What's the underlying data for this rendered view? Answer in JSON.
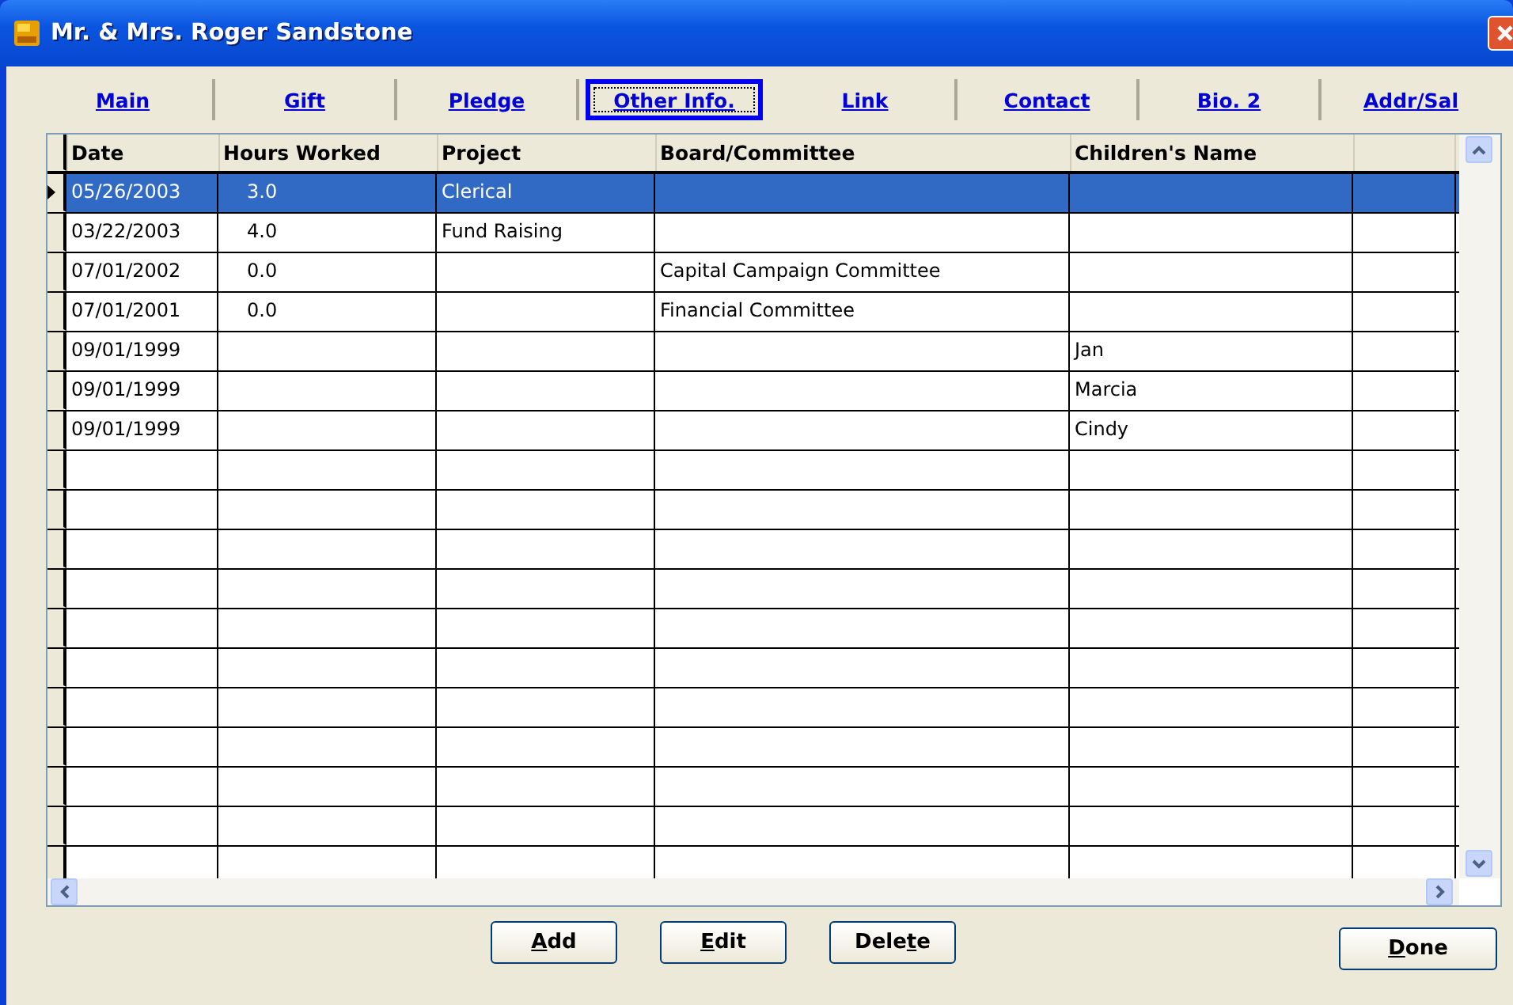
{
  "window": {
    "title": "Mr. & Mrs. Roger Sandstone"
  },
  "tabs": [
    {
      "label": "Main",
      "selected": false
    },
    {
      "label": "Gift",
      "selected": false
    },
    {
      "label": "Pledge",
      "selected": false
    },
    {
      "label": "Other Info.",
      "selected": true
    },
    {
      "label": "Link",
      "selected": false
    },
    {
      "label": "Contact",
      "selected": false
    },
    {
      "label": "Bio. 2",
      "selected": false
    },
    {
      "label": "Addr/Sal",
      "selected": false
    }
  ],
  "table": {
    "columns": [
      "Date",
      "Hours Worked",
      "Project",
      "Board/Committee",
      "Children's Name"
    ],
    "rows": [
      {
        "selected": true,
        "cells": [
          "05/26/2003",
          "3.0",
          "Clerical",
          "",
          ""
        ]
      },
      {
        "selected": false,
        "cells": [
          "03/22/2003",
          "4.0",
          "Fund Raising",
          "",
          ""
        ]
      },
      {
        "selected": false,
        "cells": [
          "07/01/2002",
          "0.0",
          "",
          "Capital Campaign Committee",
          ""
        ]
      },
      {
        "selected": false,
        "cells": [
          "07/01/2001",
          "0.0",
          "",
          "Financial Committee",
          ""
        ]
      },
      {
        "selected": false,
        "cells": [
          "09/01/1999",
          "",
          "",
          "",
          "Jan"
        ]
      },
      {
        "selected": false,
        "cells": [
          "09/01/1999",
          "",
          "",
          "",
          "Marcia"
        ]
      },
      {
        "selected": false,
        "cells": [
          "09/01/1999",
          "",
          "",
          "",
          "Cindy"
        ]
      }
    ]
  },
  "buttons": [
    {
      "key": "A",
      "after": "dd"
    },
    {
      "key": "E",
      "after": "dit"
    },
    {
      "before": "Dele",
      "key": "t",
      "after": "e"
    }
  ],
  "done_button": {
    "key": "D",
    "after": "one"
  }
}
